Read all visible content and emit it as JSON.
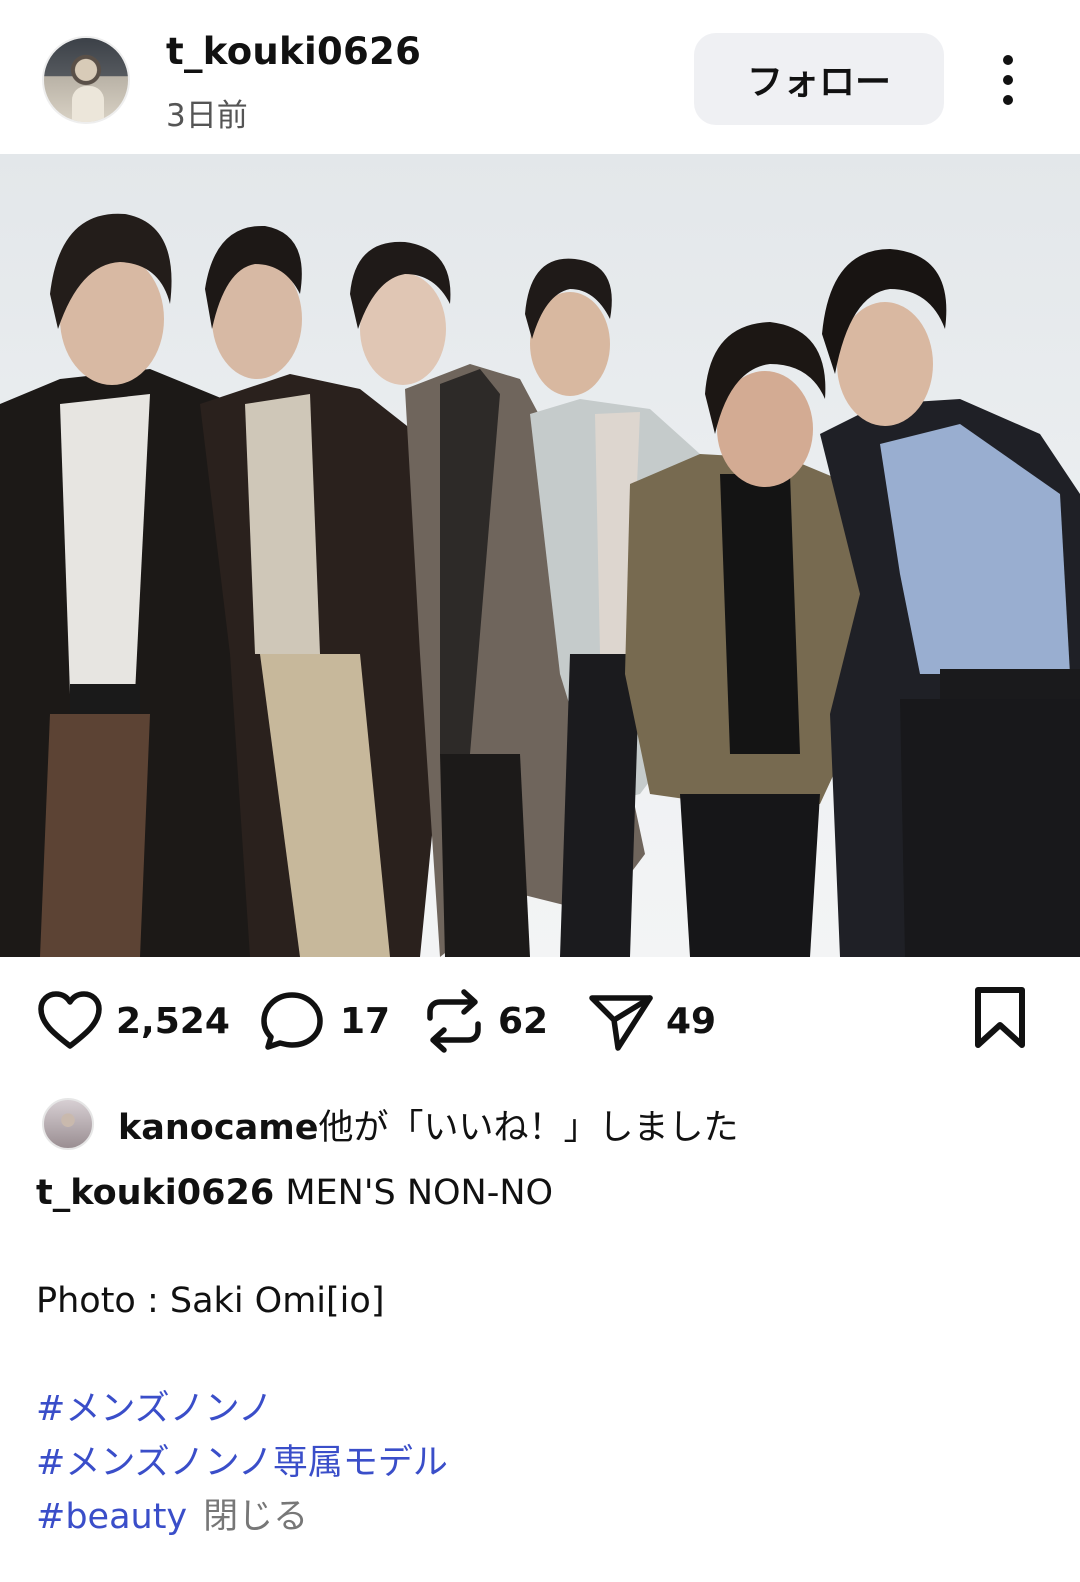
{
  "header": {
    "username": "t_kouki0626",
    "timestamp": "3日前",
    "follow_label": "フォロー",
    "avatar_icon": "profile-avatar",
    "more_icon": "more-vertical-icon"
  },
  "actions": {
    "like_count": "2,524",
    "comment_count": "17",
    "repost_count": "62",
    "share_count": "49",
    "icons": [
      "heart-icon",
      "comment-icon",
      "repost-icon",
      "share-icon",
      "bookmark-icon"
    ]
  },
  "likes": {
    "user": "kanocame",
    "suffix": "他が「いいね！」しました"
  },
  "caption": {
    "user": "t_kouki0626",
    "text": "MEN'S NON-NO",
    "credit": "Photo : Saki Omi[io]",
    "hashtags": [
      "#メンズノンノ",
      "#メンズノンノ専属モデル",
      "#beauty"
    ],
    "close_label": "閉じる"
  },
  "colors": {
    "hashtag": "#3a4ec9",
    "follow_button_bg": "#eff0f3"
  }
}
